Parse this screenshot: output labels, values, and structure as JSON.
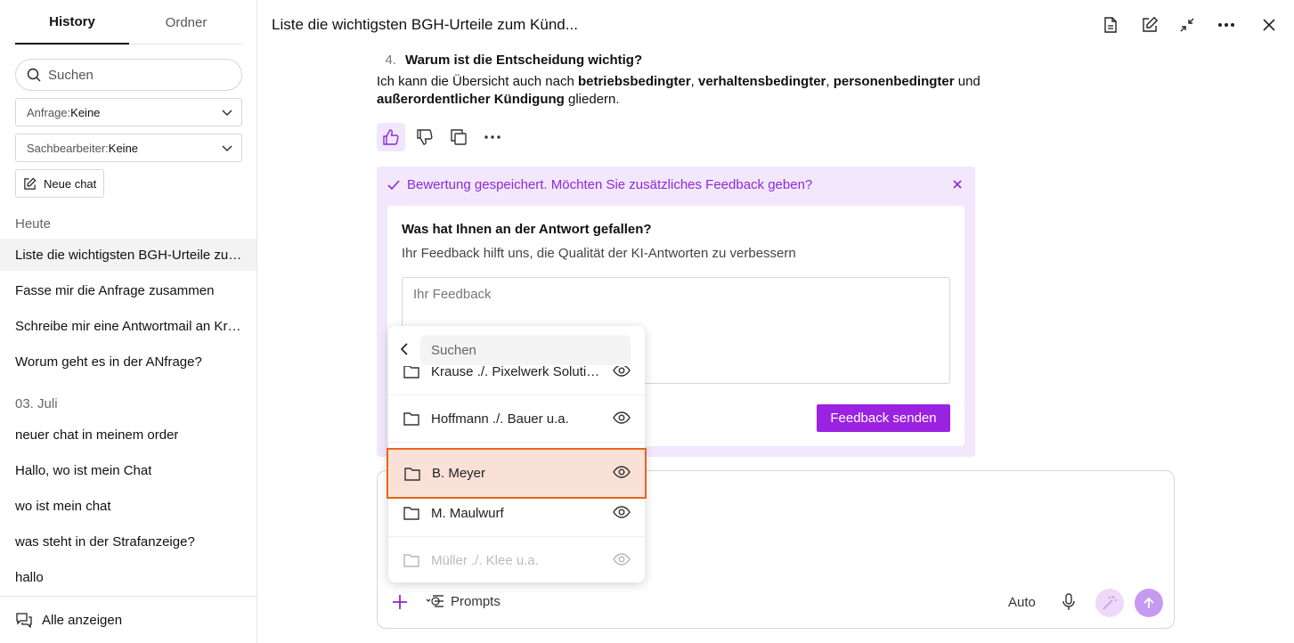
{
  "sidebar": {
    "tabs": [
      {
        "label": "History"
      },
      {
        "label": "Ordner"
      }
    ],
    "search_placeholder": "Suchen",
    "filters": [
      {
        "label": "Anfrage:",
        "value": "Keine"
      },
      {
        "label": "Sachbearbeiter:",
        "value": "Keine"
      }
    ],
    "new_chat_label": "Neue chat",
    "sections": [
      {
        "label": "Heute",
        "items": [
          "Liste die wichtigsten BGH-Urteile zum Kündigungsschutz",
          "Fasse mir die Anfrage zusammen",
          "Schreibe mir eine Antwortmail an Krause",
          "Worum geht es in der ANfrage?"
        ]
      },
      {
        "label": "03. Juli",
        "items": [
          "neuer chat in meinem order",
          "Hallo, wo ist mein Chat",
          "wo ist mein chat",
          "was steht in der Strafanzeige?",
          "hallo"
        ]
      }
    ],
    "show_all_label": "Alle anzeigen"
  },
  "header": {
    "title": "Liste die wichtigsten BGH-Urteile zum Künd..."
  },
  "answer": {
    "list_number": "4.",
    "list_item": "Warum ist die Entscheidung wichtig?",
    "p_start": "Ich kann die Übersicht auch nach ",
    "b1": "betriebsbedingter",
    "sep1": ", ",
    "b2": "verhaltensbedingter",
    "sep2": ", ",
    "b3": "personenbedingter",
    "sep3": " und ",
    "b4": "außerordentlicher Kündigung",
    "p_end": " gliedern."
  },
  "feedback": {
    "saved_message": "Bewertung gespeichert. Möchten Sie zusätzliches Feedback geben?",
    "question": "Was hat Ihnen an der Antwort gefallen?",
    "subtitle": "Ihr Feedback hilft uns, die Qualität der KI-Antworten zu verbessern",
    "placeholder": "Ihr Feedback",
    "send_label": "Feedback senden",
    "accent": "#9b22e0"
  },
  "composer": {
    "prompts_label": "Prompts",
    "mode_label": "Auto"
  },
  "popup": {
    "search_placeholder": "Suchen",
    "folders": [
      "Krause ./. Pixelwerk Solutions GmbH",
      "Hoffmann ./. Bauer u.a.",
      "B. Meyer",
      "M. Maulwurf",
      "Müller ./. Klee u.a."
    ],
    "highlight_color": "#e8641b"
  }
}
